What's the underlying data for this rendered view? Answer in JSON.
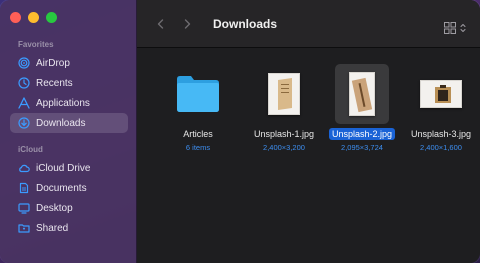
{
  "window": {
    "title": "Downloads"
  },
  "sidebar": {
    "favorites_label": "Favorites",
    "icloud_label": "iCloud",
    "favorites": [
      {
        "label": "AirDrop",
        "icon": "airdrop-icon"
      },
      {
        "label": "Recents",
        "icon": "clock-icon"
      },
      {
        "label": "Applications",
        "icon": "applications-icon"
      },
      {
        "label": "Downloads",
        "icon": "download-icon",
        "active": true
      }
    ],
    "icloud": [
      {
        "label": "iCloud Drive",
        "icon": "cloud-icon"
      },
      {
        "label": "Documents",
        "icon": "document-icon"
      },
      {
        "label": "Desktop",
        "icon": "desktop-icon"
      },
      {
        "label": "Shared",
        "icon": "shared-folder-icon"
      }
    ]
  },
  "files": [
    {
      "name": "Articles",
      "sub": "6 items",
      "kind": "folder"
    },
    {
      "name": "Unsplash-1.jpg",
      "sub": "2,400×3,200",
      "kind": "image"
    },
    {
      "name": "Unsplash-2.jpg",
      "sub": "2,095×3,724",
      "kind": "image",
      "selected": true
    },
    {
      "name": "Unsplash-3.jpg",
      "sub": "2,400×1,600",
      "kind": "image"
    }
  ],
  "colors": {
    "accent": "#1a63d6",
    "folder": "#3fb4f2",
    "sub_text": "#3d8ef0"
  }
}
